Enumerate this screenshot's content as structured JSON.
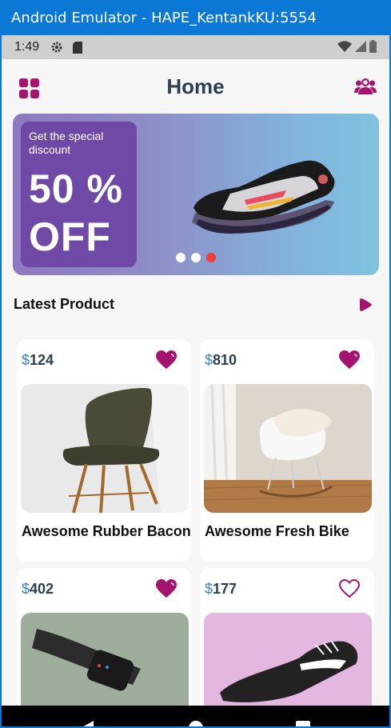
{
  "window": {
    "title": "Android Emulator - HAPE_KentankKU:5554"
  },
  "status_bar": {
    "time": "1:49",
    "icons": [
      "gear-icon",
      "sdcard-icon",
      "wifi-icon",
      "signal-icon",
      "battery-icon"
    ]
  },
  "header": {
    "title": "Home",
    "left_icon": "grid-icon",
    "right_icon": "users-icon",
    "accent": "#a4136e"
  },
  "banner": {
    "subtitle": "Get the special discount",
    "headline": "50 %",
    "headline2": "OFF",
    "slides": 3,
    "active_slide": 3,
    "active_dot_color": "#e94235"
  },
  "section": {
    "title": "Latest Product",
    "icon": "play-icon"
  },
  "products": [
    {
      "currency": "$",
      "price": "124",
      "name": "Awesome Rubber Bacon",
      "favorited": true
    },
    {
      "currency": "$",
      "price": "810",
      "name": "Awesome Fresh Bike",
      "favorited": true
    },
    {
      "currency": "$",
      "price": "402",
      "name": "",
      "favorited": true
    },
    {
      "currency": "$",
      "price": "177",
      "name": "",
      "favorited": false
    }
  ],
  "nav": {
    "icons": [
      "back-icon",
      "home-icon",
      "recents-icon"
    ]
  }
}
